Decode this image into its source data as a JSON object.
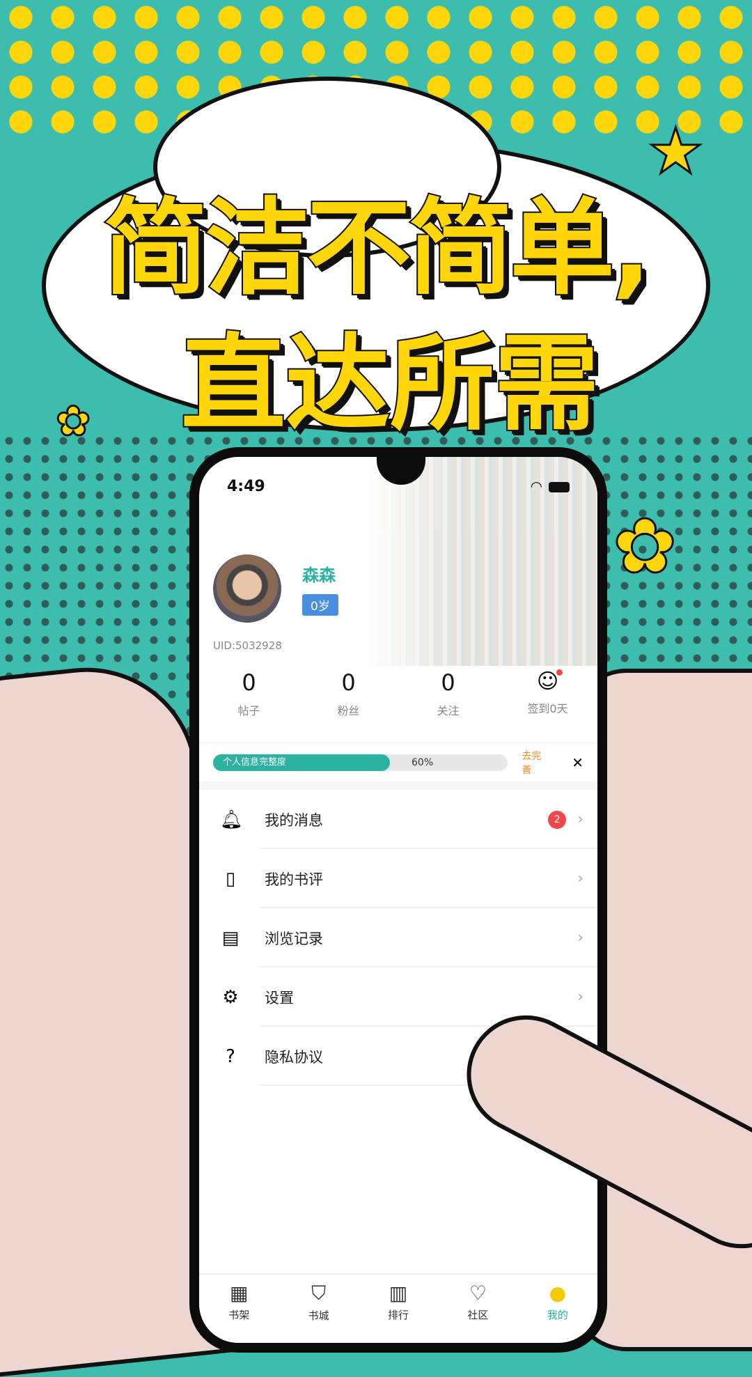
{
  "banner": {
    "line1": "简洁不简单,",
    "line2": "直达所需"
  },
  "colors": {
    "teal": "#3dbdae",
    "yellow": "#ffd60a",
    "accent": "#2bb3a2",
    "badge": "#f04848",
    "age_badge": "#4a8ee0",
    "orange": "#f38c2c"
  },
  "status_bar": {
    "time": "4:49"
  },
  "profile": {
    "name": "森森",
    "age": "0岁",
    "uid": "UID:5032928"
  },
  "stats": [
    {
      "value": "0",
      "label": "帖子"
    },
    {
      "value": "0",
      "label": "粉丝"
    },
    {
      "value": "0",
      "label": "关注"
    },
    {
      "icon": "checkin-icon",
      "label": "签到0天"
    }
  ],
  "completion": {
    "label": "个人信息完整度",
    "percent": 60,
    "percent_text": "60%",
    "action": "去完善",
    "close": "✕"
  },
  "menu": [
    {
      "icon": "bell-icon",
      "label": "我的消息",
      "badge": "2"
    },
    {
      "icon": "book-review-icon",
      "label": "我的书评"
    },
    {
      "icon": "history-icon",
      "label": "浏览记录"
    },
    {
      "icon": "gear-icon",
      "label": "设置"
    },
    {
      "icon": "question-icon",
      "label": "隐私协议"
    }
  ],
  "tabs": [
    {
      "icon": "bookshelf-icon",
      "label": "书架"
    },
    {
      "icon": "bookstore-icon",
      "label": "书城"
    },
    {
      "icon": "ranking-icon",
      "label": "排行"
    },
    {
      "icon": "community-icon",
      "label": "社区"
    },
    {
      "icon": "profile-icon",
      "label": "我的",
      "active": true
    }
  ]
}
